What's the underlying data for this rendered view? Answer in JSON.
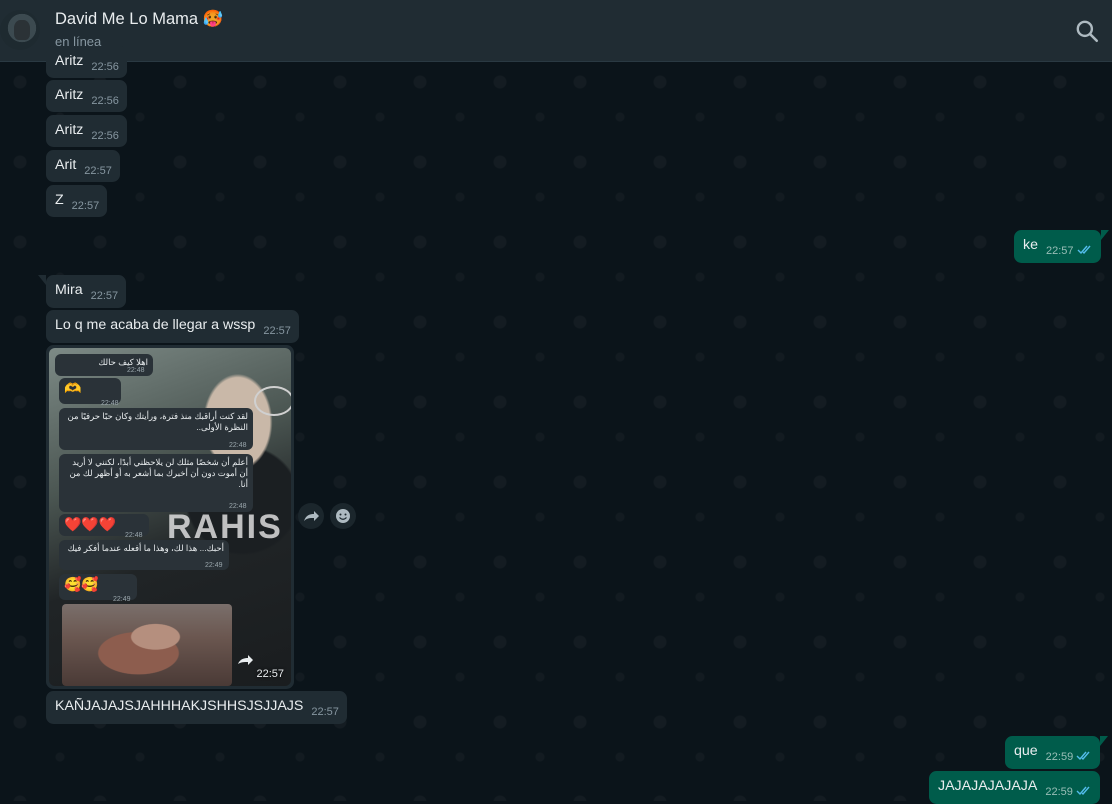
{
  "header": {
    "contact_name": "David Me Lo Mama 🥵",
    "status": "en línea"
  },
  "messages": [
    {
      "type": "in",
      "text": "Aritz",
      "time": "22:56"
    },
    {
      "type": "in",
      "text": "Aritz",
      "time": "22:56"
    },
    {
      "type": "in",
      "text": "Aritz",
      "time": "22:56"
    },
    {
      "type": "in",
      "text": "Arit",
      "time": "22:57"
    },
    {
      "type": "in",
      "text": "Z",
      "time": "22:57"
    },
    {
      "type": "out",
      "text": "ke",
      "time": "22:57"
    },
    {
      "type": "in",
      "text": "Mira",
      "time": "22:57"
    },
    {
      "type": "in",
      "text": "Lo q me acaba de llegar a wssp",
      "time": "22:57"
    },
    {
      "type": "in",
      "text": "KAÑJAJAJSJAHHHAKJSHHSJSJJAJS",
      "time": "22:57"
    },
    {
      "type": "out",
      "text": "que",
      "time": "22:59"
    },
    {
      "type": "out",
      "text": "JAJAJAJAJAJA",
      "time": "22:59"
    }
  ],
  "image_message": {
    "time": "22:57",
    "inner_messages": [
      {
        "text": "اهلا كيف حالك",
        "time": "22:48"
      },
      {
        "text": "🫶",
        "time": "22:48"
      },
      {
        "text": "لقد كنت أراقبك منذ فترة، ورأيتك وكان حبًا حرفيًا من النظرة الأولى..",
        "time": "22:48"
      },
      {
        "text": "أعلم أن شخصًا مثلك لن يلاحظني أبدًا، لكنني لا أريد أن أموت دون أن أخبرك بما أشعر به أو أظهر لك من أنا.",
        "time": "22:48"
      },
      {
        "text": "❤️❤️❤️",
        "time": "22:48"
      },
      {
        "text": "أحبك... هذا لك، وهذا ما أفعله عندما أفكر فيك",
        "time": "22:49"
      },
      {
        "text": "🥰🥰",
        "time": "22:49"
      }
    ],
    "shirt_text": "RAHIS"
  },
  "icons": {
    "search": "search-icon",
    "forward": "forward-icon",
    "emoji": "emoji-reaction-icon",
    "read_ticks": "double-check-icon"
  },
  "colors": {
    "incoming_bubble": "#202c33",
    "outgoing_bubble": "#005c4b",
    "background": "#0b141a",
    "read_ticks": "#53bdeb"
  }
}
